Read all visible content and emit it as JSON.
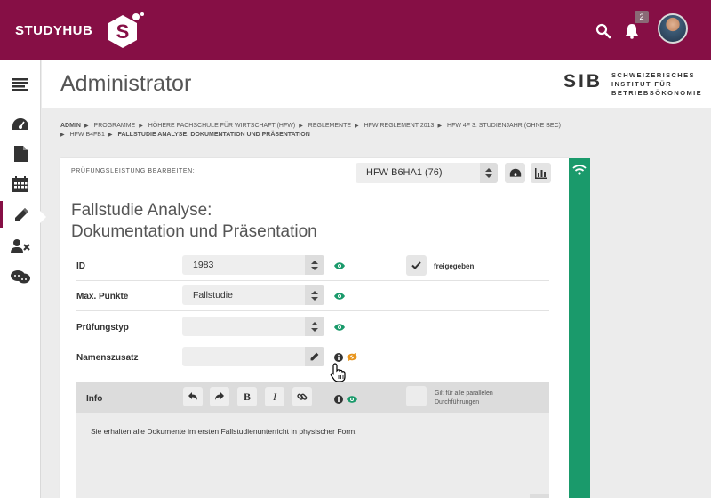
{
  "header": {
    "brand": "STUDYHUB",
    "notification_count": "2",
    "colors": {
      "brand": "#860f45",
      "accent_green": "#1a9a6b"
    }
  },
  "sidebar": {
    "items": [
      {
        "icon": "menu-icon"
      },
      {
        "icon": "dashboard-icon"
      },
      {
        "icon": "document-icon"
      },
      {
        "icon": "calendar-icon"
      },
      {
        "icon": "pencil-icon",
        "active": true
      },
      {
        "icon": "user-remove-icon"
      },
      {
        "icon": "chat-icon"
      }
    ]
  },
  "page": {
    "title": "Administrator",
    "org_short": "SIB",
    "org_long_line1": "SCHWEIZERISCHES",
    "org_long_line2": "INSTITUT FÜR",
    "org_long_line3": "BETRIEBSÖKONOMIE"
  },
  "breadcrumb": [
    "ADMIN",
    "PROGRAMME",
    "HÖHERE FACHSCHULE FÜR WIRTSCHAFT (HFW)",
    "REGLEMENTE",
    "HFW REGLEMENT 2013",
    "HFW 4F 3. STUDIENJAHR (OHNE BEC)",
    "HFW B4FB1",
    "FALLSTUDIE ANALYSE: DOKUMENTATION UND PRÄSENTATION"
  ],
  "form": {
    "edit_label": "PRÜFUNGSLEISTUNG BEARBEITEN:",
    "selected_exam": "HFW B6HA1 (76)",
    "title_line1": "Fallstudie Analyse:",
    "title_line2": "Dokumentation und Präsentation",
    "fields": {
      "id_label": "ID",
      "id_value": "1983",
      "max_label": "Max. Punkte",
      "max_value": "Fallstudie",
      "type_label": "Prüfungstyp",
      "type_value": "",
      "name_label": "Namenszusatz",
      "name_value": ""
    },
    "released_label": "freigegeben",
    "info": {
      "title": "Info",
      "parallel_label": "Gilt für alle parallelen Durchführungen",
      "text": "Sie erhalten alle Dokumente im ersten Fallstudienunterricht in physischer Form."
    }
  }
}
